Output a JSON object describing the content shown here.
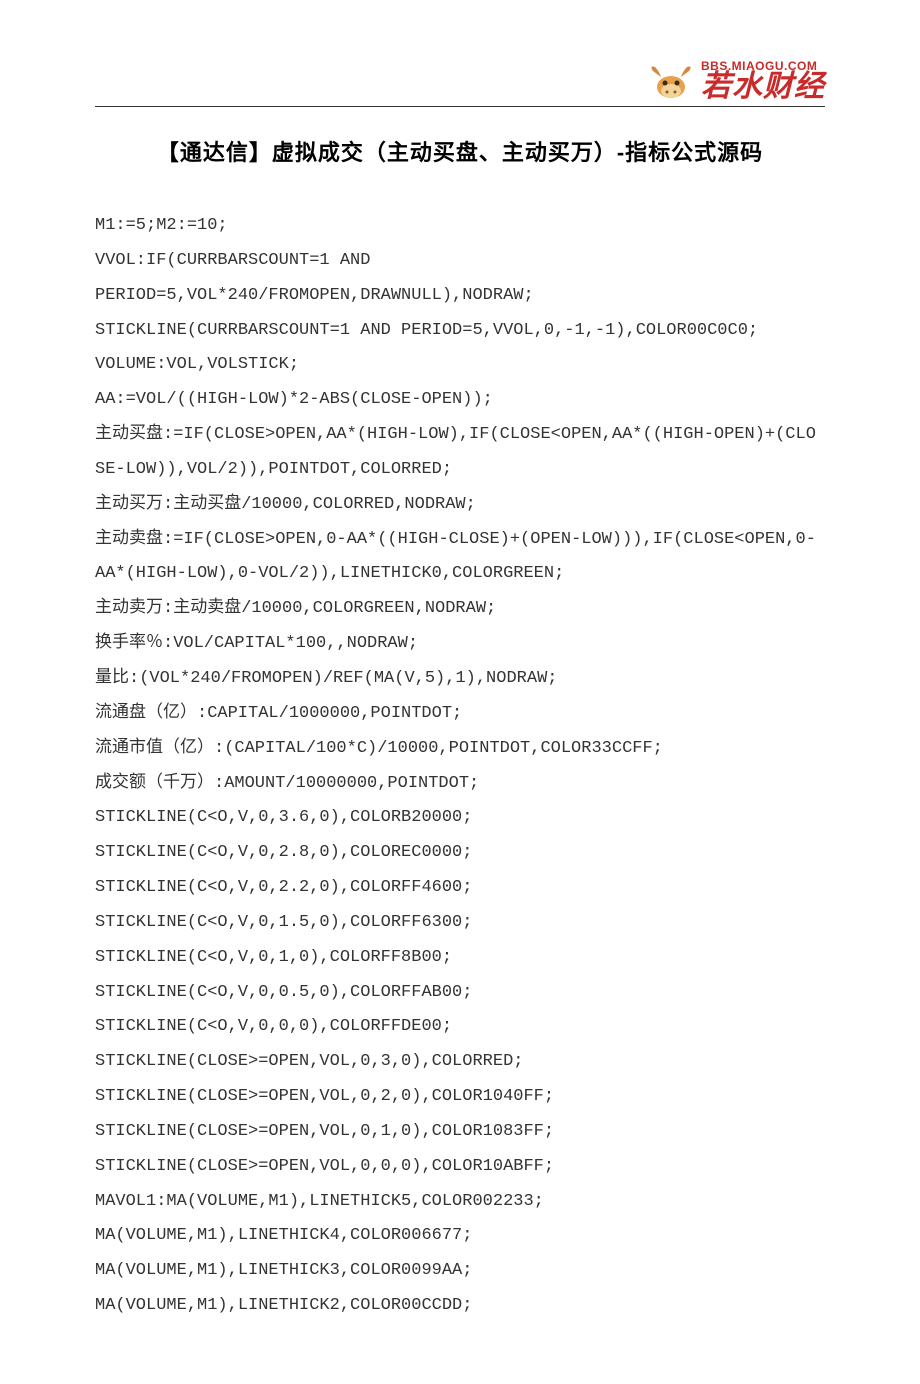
{
  "header": {
    "url": "BBS.MIAOGU.COM",
    "brand": "若水财经"
  },
  "title": "【通达信】虚拟成交（主动买盘、主动买万）-指标公式源码",
  "code": {
    "lines": [
      "M1:=5;M2:=10;",
      "VVOL:IF(CURRBARSCOUNT=1 AND",
      "PERIOD=5,VOL*240/FROMOPEN,DRAWNULL),NODRAW;",
      "STICKLINE(CURRBARSCOUNT=1 AND PERIOD=5,VVOL,0,-1,-1),COLOR00C0C0;",
      "VOLUME:VOL,VOLSTICK;",
      "AA:=VOL/((HIGH-LOW)*2-ABS(CLOSE-OPEN));",
      "主动买盘:=IF(CLOSE>OPEN,AA*(HIGH-LOW),IF(CLOSE<OPEN,AA*((HIGH-OPEN)+(CLOSE-LOW)),VOL/2)),POINTDOT,COLORRED;",
      "主动买万:主动买盘/10000,COLORRED,NODRAW;",
      "主动卖盘:=IF(CLOSE>OPEN,0-AA*((HIGH-CLOSE)+(OPEN-LOW))),IF(CLOSE<OPEN,0-AA*(HIGH-LOW),0-VOL/2)),LINETHICK0,COLORGREEN;",
      "主动卖万:主动卖盘/10000,COLORGREEN,NODRAW;",
      "换手率％:VOL/CAPITAL*100,,NODRAW;",
      "量比:(VOL*240/FROMOPEN)/REF(MA(V,5),1),NODRAW;",
      "流通盘（亿）:CAPITAL/1000000,POINTDOT;",
      "流通市值（亿）:(CAPITAL/100*C)/10000,POINTDOT,COLOR33CCFF;",
      "成交额（千万）:AMOUNT/10000000,POINTDOT;",
      "STICKLINE(C<O,V,0,3.6,0),COLORB20000;",
      "STICKLINE(C<O,V,0,2.8,0),COLOREC0000;",
      "STICKLINE(C<O,V,0,2.2,0),COLORFF4600;",
      "STICKLINE(C<O,V,0,1.5,0),COLORFF6300;",
      "STICKLINE(C<O,V,0,1,0),COLORFF8B00;",
      "STICKLINE(C<O,V,0,0.5,0),COLORFFAB00;",
      "STICKLINE(C<O,V,0,0,0),COLORFFDE00;",
      "STICKLINE(CLOSE>=OPEN,VOL,0,3,0),COLORRED;",
      "STICKLINE(CLOSE>=OPEN,VOL,0,2,0),COLOR1040FF;",
      "STICKLINE(CLOSE>=OPEN,VOL,0,1,0),COLOR1083FF;",
      "STICKLINE(CLOSE>=OPEN,VOL,0,0,0),COLOR10ABFF;",
      "MAVOL1:MA(VOLUME,M1),LINETHICK5,COLOR002233;",
      "MA(VOLUME,M1),LINETHICK4,COLOR006677;",
      "MA(VOLUME,M1),LINETHICK3,COLOR0099AA;",
      "MA(VOLUME,M1),LINETHICK2,COLOR00CCDD;"
    ]
  }
}
